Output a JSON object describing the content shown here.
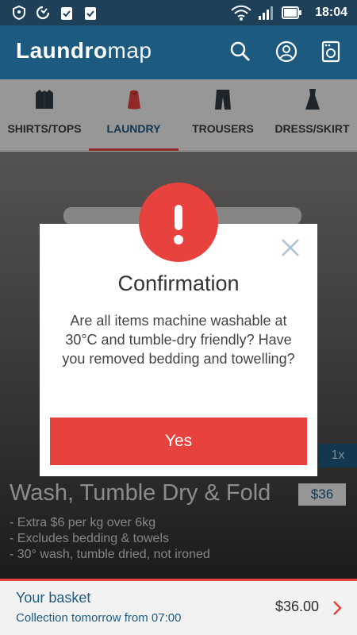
{
  "status_bar": {
    "time": "18:04",
    "icons": [
      "shield-icon",
      "sync-icon",
      "clipboard-check-icon",
      "clipboard-check-icon",
      "wifi-icon",
      "signal-icon",
      "battery-icon"
    ]
  },
  "app": {
    "logo_bold": "Laundro",
    "logo_light": "map",
    "header_icons": [
      "search-icon",
      "account-icon",
      "washing-machine-icon"
    ]
  },
  "tabs": [
    {
      "label": "SHIRTS/TOPS",
      "icon": "shirt-icon",
      "active": false
    },
    {
      "label": "LAUNDRY",
      "icon": "laundry-bag-icon",
      "active": true
    },
    {
      "label": "TROUSERS",
      "icon": "trousers-icon",
      "active": false
    },
    {
      "label": "DRESS/SKIRT",
      "icon": "dress-icon",
      "active": false
    }
  ],
  "product": {
    "title": "Wash, Tumble Dry & Fold",
    "price": "$36",
    "quantity": "1x",
    "features": [
      "- Extra $6 per kg over 6kg",
      "- Excludes bedding & towels",
      "- 30° wash, tumble dried, not ironed"
    ]
  },
  "dialog": {
    "title": "Confirmation",
    "message": "Are all items machine washable at 30°C and tumble-dry friendly? Have you removed bedding and towelling?",
    "confirm_label": "Yes",
    "icon": "alert-icon"
  },
  "basket": {
    "title": "Your basket",
    "subtitle": "Collection tomorrow from 07:00",
    "total": "$36.00"
  },
  "colors": {
    "header": "#1d5a80",
    "status": "#1e4159",
    "accent": "#e8423f"
  }
}
